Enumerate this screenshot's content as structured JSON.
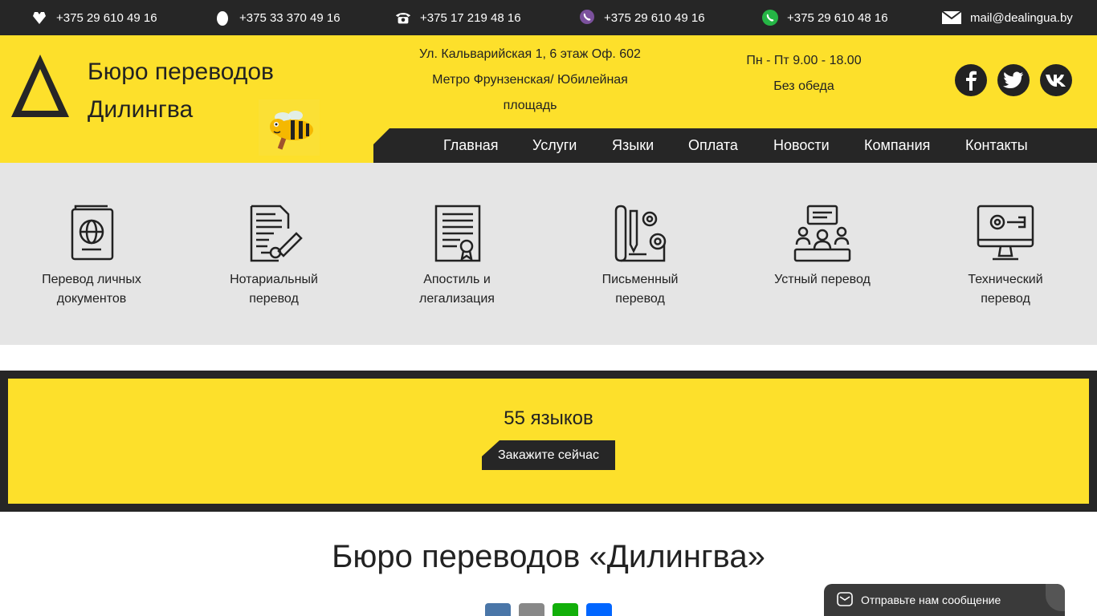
{
  "topbar": {
    "contacts": [
      {
        "icon": "mts-icon",
        "text": "+375 29 610 49 16"
      },
      {
        "icon": "life-icon",
        "text": "+375 33 370 49 16"
      },
      {
        "icon": "phone-icon",
        "text": "+375 17 219 48 16"
      },
      {
        "icon": "viber-icon",
        "text": "+375 29 610 49 16"
      },
      {
        "icon": "whatsapp-icon",
        "text": "+375 29 610 48 16"
      },
      {
        "icon": "mail-icon",
        "text": "mail@dealingua.by"
      }
    ]
  },
  "header": {
    "brand_line1": "Бюро переводов",
    "brand_line2": "Дилингва",
    "address_line1": "Ул. Кальварийская 1, 6 этаж Оф. 602",
    "address_line2": "Метро Фрунзенская/ Юбилейная",
    "address_line3": "площадь",
    "hours_line1": "Пн - Пт 9.00 - 18.00",
    "hours_line2": "Без обеда",
    "social": [
      "facebook-icon",
      "twitter-icon",
      "vk-icon"
    ]
  },
  "nav": {
    "items": [
      "Главная",
      "Услуги",
      "Языки",
      "Оплата",
      "Новости",
      "Компания",
      "Контакты"
    ]
  },
  "services": {
    "items": [
      {
        "icon": "passport-icon",
        "line1": "Перевод личных",
        "line2": "документов"
      },
      {
        "icon": "notary-document-icon",
        "line1": "Нотариальный",
        "line2": "перевод"
      },
      {
        "icon": "certificate-icon",
        "line1": "Апостиль и",
        "line2": "легализация"
      },
      {
        "icon": "written-translation-icon",
        "line1": "Письменный",
        "line2": "перевод"
      },
      {
        "icon": "interpreting-icon",
        "line1": "Устный перевод",
        "line2": ""
      },
      {
        "icon": "technical-monitor-icon",
        "line1": "Технический",
        "line2": "перевод"
      }
    ]
  },
  "banner": {
    "title": "55 языков",
    "button": "Закажите сейчас"
  },
  "main": {
    "title": "Бюро переводов «Дилингва»"
  },
  "share": [
    "vk-share-icon",
    "email-share-icon",
    "whatsapp-share-icon",
    "share-icon"
  ],
  "chat": {
    "label": "Отправьте нам сообщение"
  },
  "colors": {
    "yellow": "#fde02b",
    "dark": "#262626",
    "grey": "#e5e5e5"
  }
}
